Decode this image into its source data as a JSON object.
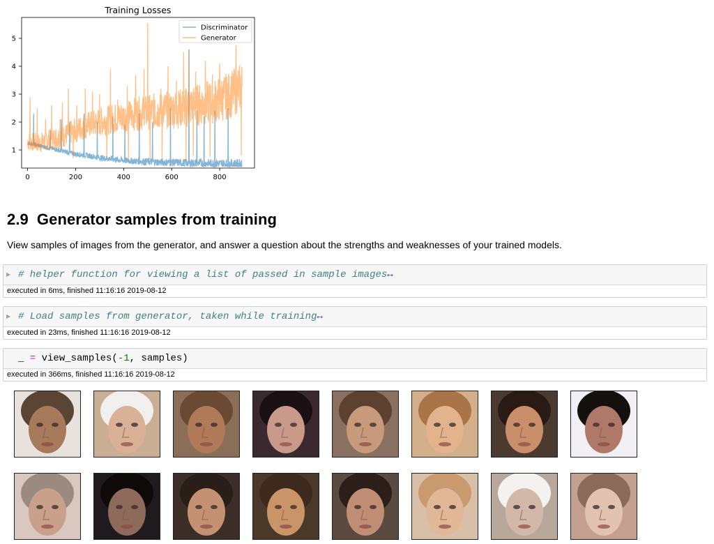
{
  "chart_data": {
    "type": "line",
    "title": "Training Losses",
    "xlabel": "",
    "ylabel": "",
    "xlim": [
      -25,
      945
    ],
    "ylim": [
      0.35,
      5.75
    ],
    "xticks": [
      0,
      200,
      400,
      600,
      800
    ],
    "yticks": [
      1,
      2,
      3,
      4,
      5
    ],
    "legend_position": "top-right",
    "grid": false,
    "n_points": 894,
    "series": [
      {
        "name": "Discriminator",
        "color": "#1f77b4",
        "x": [
          0,
          50,
          100,
          150,
          200,
          250,
          300,
          350,
          400,
          450,
          500,
          550,
          600,
          650,
          700,
          750,
          800,
          850,
          893
        ],
        "values": [
          1.25,
          1.15,
          1.05,
          0.95,
          0.85,
          0.8,
          0.72,
          0.68,
          0.62,
          0.6,
          0.58,
          0.56,
          0.55,
          0.54,
          0.53,
          0.52,
          0.51,
          0.5,
          0.5
        ]
      },
      {
        "name": "Generator",
        "color": "#ff7f0e",
        "x": [
          0,
          50,
          100,
          150,
          200,
          250,
          300,
          350,
          400,
          450,
          500,
          550,
          600,
          650,
          700,
          750,
          800,
          850,
          893
        ],
        "values": [
          1.3,
          1.25,
          1.4,
          1.5,
          1.7,
          1.9,
          2.0,
          2.1,
          2.2,
          2.3,
          2.35,
          2.4,
          2.45,
          2.5,
          2.6,
          2.7,
          2.8,
          3.0,
          3.3
        ]
      }
    ],
    "spikes": {
      "Generator": [
        {
          "x": 10,
          "y": 2.9
        },
        {
          "x": 40,
          "y": 2.5
        },
        {
          "x": 75,
          "y": 2.1
        },
        {
          "x": 100,
          "y": 2.6
        },
        {
          "x": 135,
          "y": 2.1
        },
        {
          "x": 145,
          "y": 2.7
        },
        {
          "x": 170,
          "y": 3.2
        },
        {
          "x": 205,
          "y": 2.6
        },
        {
          "x": 240,
          "y": 3.2
        },
        {
          "x": 270,
          "y": 3.1
        },
        {
          "x": 300,
          "y": 3.0
        },
        {
          "x": 320,
          "y": 2.0
        },
        {
          "x": 345,
          "y": 3.9
        },
        {
          "x": 375,
          "y": 2.8
        },
        {
          "x": 415,
          "y": 3.3
        },
        {
          "x": 450,
          "y": 3.7
        },
        {
          "x": 485,
          "y": 3.9
        },
        {
          "x": 500,
          "y": 5.55
        },
        {
          "x": 530,
          "y": 2.8
        },
        {
          "x": 555,
          "y": 3.2
        },
        {
          "x": 585,
          "y": 4.0
        },
        {
          "x": 620,
          "y": 3.5
        },
        {
          "x": 650,
          "y": 4.5
        },
        {
          "x": 672,
          "y": 4.6
        },
        {
          "x": 700,
          "y": 3.8
        },
        {
          "x": 740,
          "y": 4.2
        },
        {
          "x": 770,
          "y": 3.7
        },
        {
          "x": 800,
          "y": 4.1
        },
        {
          "x": 823,
          "y": 3.6
        },
        {
          "x": 845,
          "y": 2.3
        },
        {
          "x": 868,
          "y": 4.75
        },
        {
          "x": 885,
          "y": 3.55
        }
      ],
      "Discriminator": [
        {
          "x": 25,
          "y": 2.3
        },
        {
          "x": 95,
          "y": 1.7
        },
        {
          "x": 140,
          "y": 2.1
        },
        {
          "x": 175,
          "y": 2.0
        },
        {
          "x": 235,
          "y": 2.3
        },
        {
          "x": 290,
          "y": 2.0
        },
        {
          "x": 355,
          "y": 2.2
        },
        {
          "x": 405,
          "y": 1.9
        },
        {
          "x": 465,
          "y": 2.3
        },
        {
          "x": 520,
          "y": 2.0
        },
        {
          "x": 595,
          "y": 2.5
        },
        {
          "x": 672,
          "y": 4.6
        },
        {
          "x": 705,
          "y": 2.4
        },
        {
          "x": 735,
          "y": 2.2
        },
        {
          "x": 780,
          "y": 2.4
        },
        {
          "x": 835,
          "y": 2.5
        }
      ],
      "Generator_dips": [
        {
          "x": 190,
          "y": 0.7
        },
        {
          "x": 330,
          "y": 0.75
        },
        {
          "x": 420,
          "y": 0.6
        },
        {
          "x": 510,
          "y": 0.65
        },
        {
          "x": 560,
          "y": 0.7
        },
        {
          "x": 660,
          "y": 0.6
        },
        {
          "x": 690,
          "y": 0.8
        },
        {
          "x": 760,
          "y": 0.75
        },
        {
          "x": 890,
          "y": 0.8
        }
      ]
    }
  },
  "section": {
    "number": "2.9",
    "title": "Generator samples from training",
    "description": "View samples of images from the generator, and answer a question about the strengths and weaknesses of your trained models."
  },
  "cells": [
    {
      "code": "# helper function for viewing a list of passed in sample images",
      "ellipsis": "↔",
      "exec": "executed in 6ms, finished 11:16:16 2019-08-12",
      "collapsed": true
    },
    {
      "code": "# Load samples from generator, taken while training",
      "ellipsis": "↔",
      "exec": "executed in 23ms, finished 11:16:16 2019-08-12",
      "collapsed": true
    },
    {
      "code_parts": [
        "_ ",
        "=",
        " view_samples(",
        "-1",
        ", samples)"
      ],
      "exec": "executed in 366ms, finished 11:16:16 2019-08-12",
      "collapsed": false
    }
  ],
  "samples": [
    [
      {
        "skin": "#a87a5c",
        "hair": "#5a4433",
        "bg": "#e8e2de"
      },
      {
        "skin": "#d9b196",
        "hair": "#f2f0ee",
        "bg": "#c9ad95"
      },
      {
        "skin": "#b07a58",
        "hair": "#6b4a33",
        "bg": "#8a6e58"
      },
      {
        "skin": "#c9998a",
        "hair": "#1a1014",
        "bg": "#3a2a30"
      },
      {
        "skin": "#c69a7a",
        "hair": "#5c4030",
        "bg": "#8a7060"
      },
      {
        "skin": "#e2b38c",
        "hair": "#a87448",
        "bg": "#d4b08a"
      },
      {
        "skin": "#c98e6a",
        "hair": "#2a1a14",
        "bg": "#4a3a30"
      },
      {
        "skin": "#b07868",
        "hair": "#14100e",
        "bg": "#f2f0f4"
      }
    ],
    [
      {
        "skin": "#c9a08a",
        "hair": "#9a8a80",
        "bg": "#d8c8c0"
      },
      {
        "skin": "#8e6a5a",
        "hair": "#0e0a0a",
        "bg": "#1e1a1e"
      },
      {
        "skin": "#c49272",
        "hair": "#2a1e18",
        "bg": "#3a2e26"
      },
      {
        "skin": "#c99468",
        "hair": "#3e2a1c",
        "bg": "#4a3828"
      },
      {
        "skin": "#c08e74",
        "hair": "#2c1e18",
        "bg": "#5a4a40"
      },
      {
        "skin": "#e0b898",
        "hair": "#c89a6e",
        "bg": "#d8c0a8"
      },
      {
        "skin": "#d2b8a8",
        "hair": "#f4f2f0",
        "bg": "#b8a89c"
      },
      {
        "skin": "#e2c2b0",
        "hair": "#8a6a58",
        "bg": "#c4a090"
      }
    ]
  ]
}
